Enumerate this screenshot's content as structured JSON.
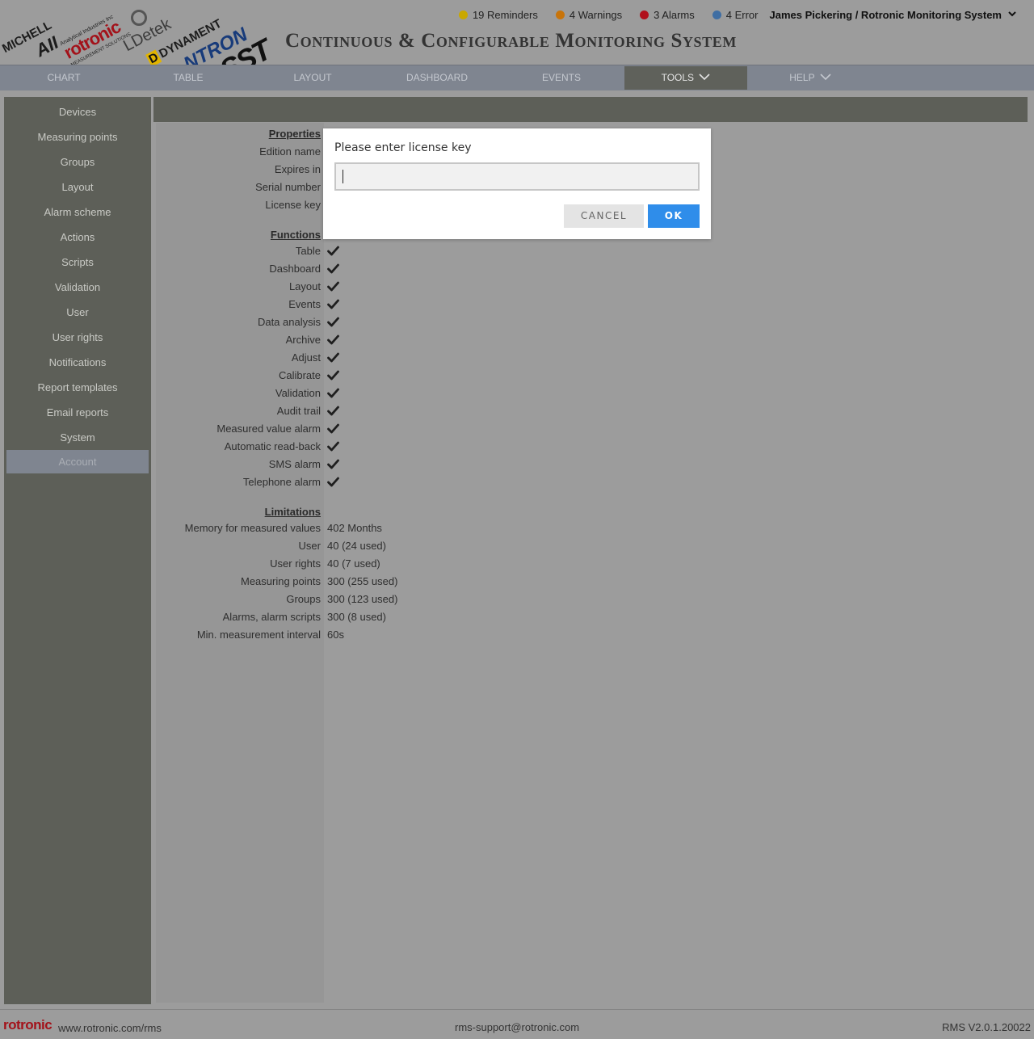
{
  "header": {
    "logos": {
      "michell": "MICHELL",
      "ai": "AII",
      "ai_sub": "Analytical Industries Inc",
      "rotronic": "rotronic",
      "rotronic_sub": "MEASUREMENT SOLUTIONS",
      "ldetek": "LDetek",
      "dynament": "DYNAMENT",
      "dynament_d": "D",
      "ntron": "NTRON",
      "sst": "SST"
    },
    "app_title": "Continuous & Configurable Monitoring System",
    "status": [
      {
        "label": "19 Reminders",
        "color": "#c9a800"
      },
      {
        "label": "4 Warnings",
        "color": "#c8740a"
      },
      {
        "label": "3 Alarms",
        "color": "#b0101c"
      },
      {
        "label": "4 Error",
        "color": "#3f6ea3"
      }
    ],
    "user": "James Pickering / Rotronic Monitoring System"
  },
  "nav": {
    "items": [
      {
        "label": "CHART"
      },
      {
        "label": "TABLE"
      },
      {
        "label": "LAYOUT"
      },
      {
        "label": "DASHBOARD"
      },
      {
        "label": "EVENTS"
      },
      {
        "label": "TOOLS"
      },
      {
        "label": "HELP"
      }
    ],
    "active": "TOOLS"
  },
  "sidebar": {
    "items": [
      {
        "label": "Devices"
      },
      {
        "label": "Measuring points"
      },
      {
        "label": "Groups"
      },
      {
        "label": "Layout"
      },
      {
        "label": "Alarm scheme"
      },
      {
        "label": "Actions"
      },
      {
        "label": "Scripts"
      },
      {
        "label": "Validation"
      },
      {
        "label": "User"
      },
      {
        "label": "User rights"
      },
      {
        "label": "Notifications"
      },
      {
        "label": "Report templates"
      },
      {
        "label": "Email reports"
      },
      {
        "label": "System"
      },
      {
        "label": "Account"
      }
    ],
    "active": "Account"
  },
  "account": {
    "properties_title": "Properties",
    "properties": [
      {
        "label": "Edition name"
      },
      {
        "label": "Expires in"
      },
      {
        "label": "Serial number"
      },
      {
        "label": "License key"
      }
    ],
    "functions_title": "Functions",
    "functions": [
      {
        "label": "Table",
        "enabled": true
      },
      {
        "label": "Dashboard",
        "enabled": true
      },
      {
        "label": "Layout",
        "enabled": true
      },
      {
        "label": "Events",
        "enabled": true
      },
      {
        "label": "Data analysis",
        "enabled": true
      },
      {
        "label": "Archive",
        "enabled": true
      },
      {
        "label": "Adjust",
        "enabled": true
      },
      {
        "label": "Calibrate",
        "enabled": true
      },
      {
        "label": "Validation",
        "enabled": true
      },
      {
        "label": "Audit trail",
        "enabled": true
      },
      {
        "label": "Measured value alarm",
        "enabled": true
      },
      {
        "label": "Automatic read-back",
        "enabled": true
      },
      {
        "label": "SMS alarm",
        "enabled": true
      },
      {
        "label": "Telephone alarm",
        "enabled": true
      }
    ],
    "limitations_title": "Limitations",
    "limitations": [
      {
        "label": "Memory for measured values",
        "value": "402 Months"
      },
      {
        "label": "User",
        "value": "40 (24 used)"
      },
      {
        "label": "User rights",
        "value": "40 (7 used)"
      },
      {
        "label": "Measuring points",
        "value": "300 (255 used)"
      },
      {
        "label": "Groups",
        "value": "300 (123 used)"
      },
      {
        "label": "Alarms, alarm scripts",
        "value": "300 (8 used)"
      },
      {
        "label": "Min. measurement interval",
        "value": "60s"
      }
    ]
  },
  "modal": {
    "prompt": "Please enter license key",
    "input_value": "",
    "cancel_label": "CANCEL",
    "ok_label": "OK"
  },
  "footer": {
    "logo": "rotronic",
    "website": "www.rotronic.com/rms",
    "email": "rms-support@rotronic.com",
    "version": "RMS V2.0.1.20022"
  }
}
